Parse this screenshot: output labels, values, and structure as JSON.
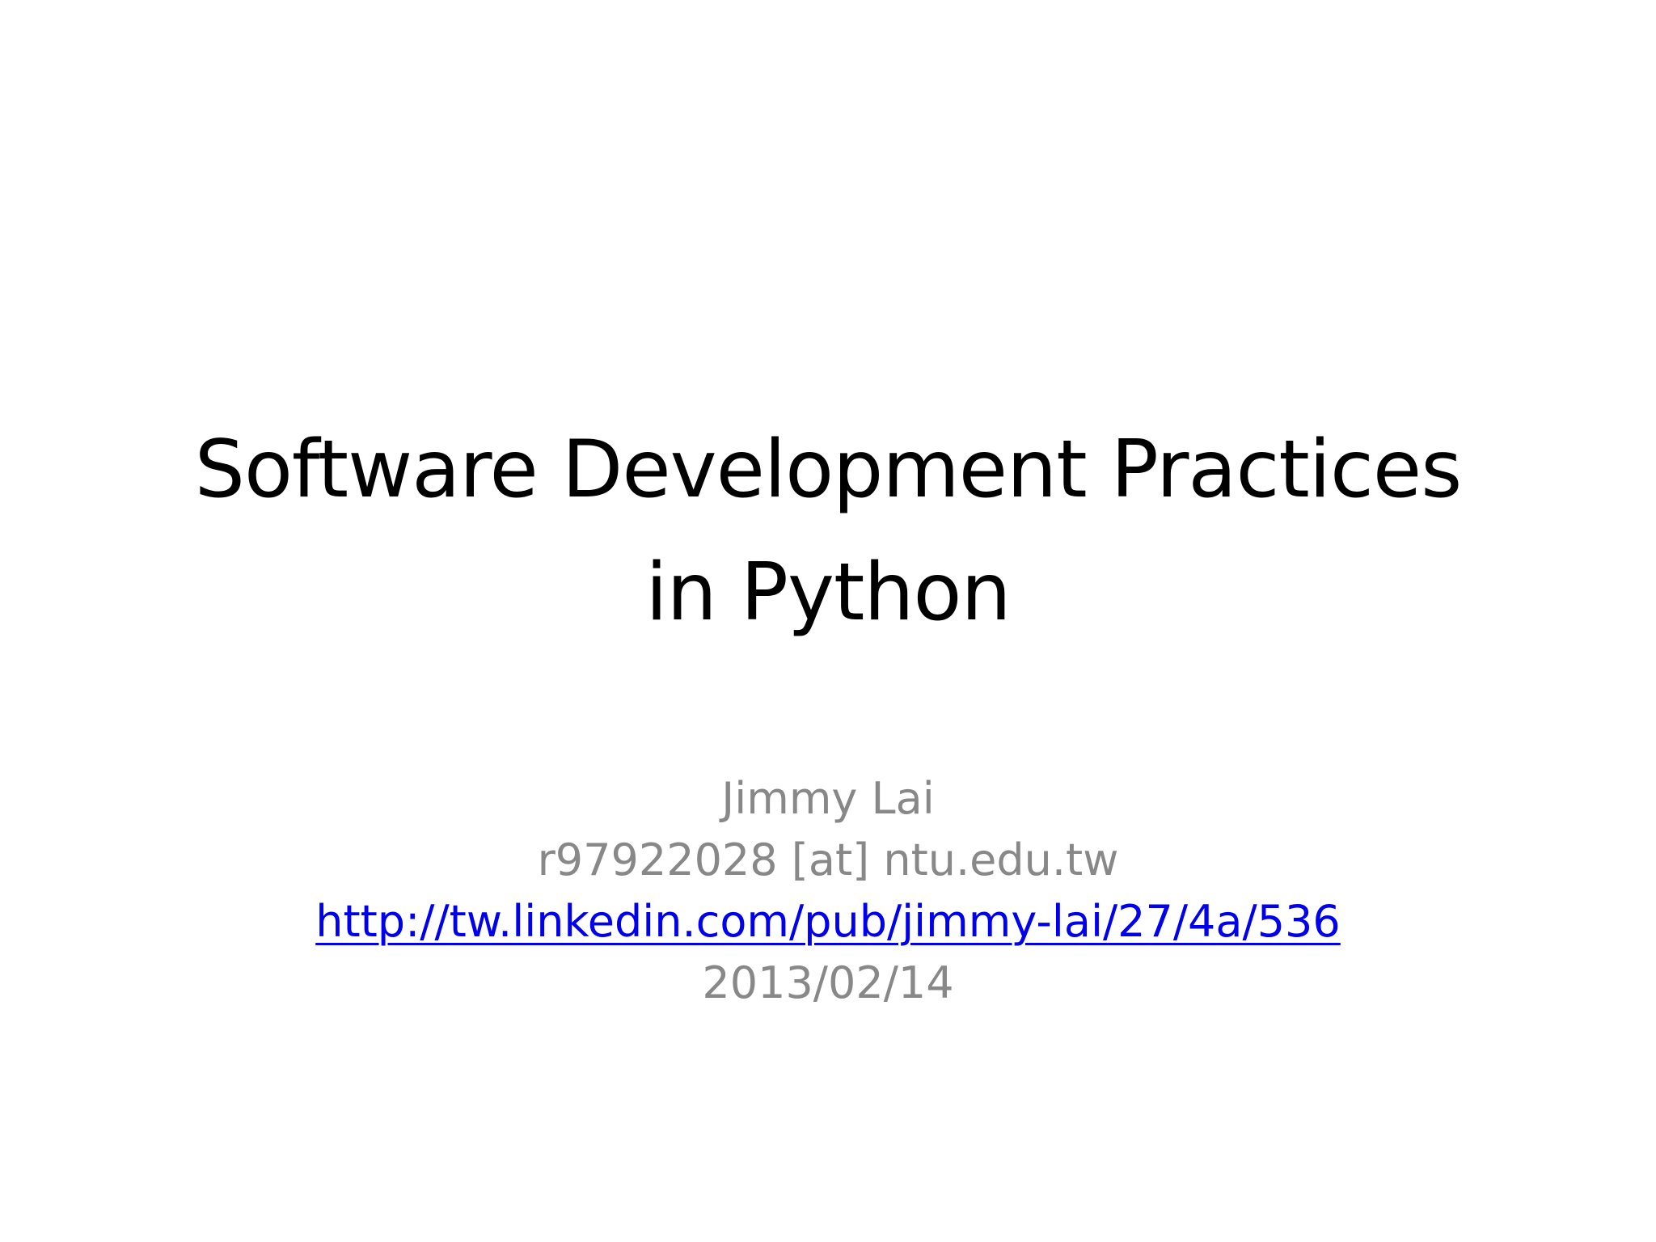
{
  "slide": {
    "title_line1": "Software Development Practices",
    "title_line2": "in Python",
    "author": "Jimmy Lai",
    "email": "r97922028 [at] ntu.edu.tw",
    "link": "http://tw.linkedin.com/pub/jimmy-lai/27/4a/536",
    "date": "2013/02/14"
  },
  "colors": {
    "title": "#000000",
    "subtitle": "#888888",
    "link": "#0000ee",
    "background": "#ffffff"
  }
}
